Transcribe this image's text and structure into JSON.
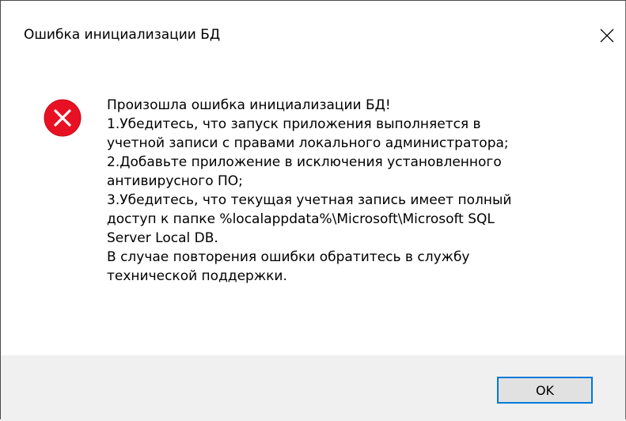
{
  "dialog": {
    "title": "Ошибка инициализации БД",
    "close_icon": "close-icon",
    "error_icon": "error-icon",
    "accent_color": "#0078d7",
    "error_color": "#e81123",
    "message_lines": [
      "Произошла ошибка инициализации БД!",
      "1.Убедитесь, что запуск приложения выполняется в",
      "учетной записи с правами локального администратора;",
      "2.Добавьте приложение в исключения установленного",
      "антивирусного ПО;",
      "3.Убедитесь, что текущая учетная запись имеет полный",
      "доступ к папке %localappdata%\\Microsoft\\Microsoft SQL",
      "Server Local DB.",
      "В случае повторения ошибки обратитесь в службу",
      "технической поддержки."
    ],
    "ok_label": "OK"
  }
}
